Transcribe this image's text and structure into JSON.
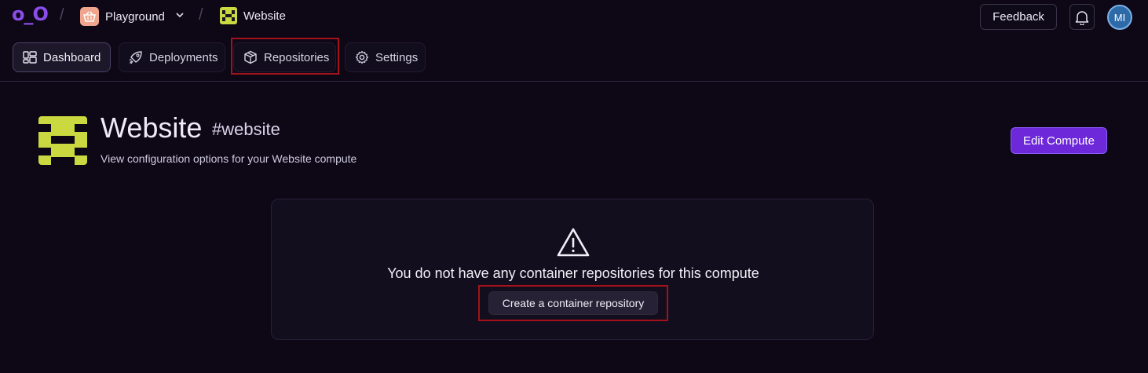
{
  "logo": {
    "text": "o_O",
    "color": "#8b4dea"
  },
  "breadcrumb": [
    {
      "label": "Playground",
      "icon": "basket-icon"
    },
    {
      "label": "Website",
      "icon": "website-project-icon"
    }
  ],
  "header": {
    "feedback_label": "Feedback",
    "user_initials": "MI"
  },
  "tabs": [
    {
      "label": "Dashboard",
      "icon": "dashboard-icon",
      "active": true
    },
    {
      "label": "Deployments",
      "icon": "rocket-icon",
      "active": false
    },
    {
      "label": "Repositories",
      "icon": "box-icon",
      "active": false,
      "highlighted": true
    },
    {
      "label": "Settings",
      "icon": "gear-icon",
      "active": false
    }
  ],
  "project": {
    "title": "Website",
    "tag": "#website",
    "subtitle": "View configuration options for your Website compute",
    "edit_button": "Edit Compute",
    "accent": "#c9d93f"
  },
  "empty_state": {
    "message": "You do not have any container repositories for this compute",
    "button": "Create a container repository",
    "highlighted": true
  },
  "colors": {
    "background": "#0d0716",
    "primary_button": "#6d28d9",
    "highlight": "#a3121a"
  }
}
